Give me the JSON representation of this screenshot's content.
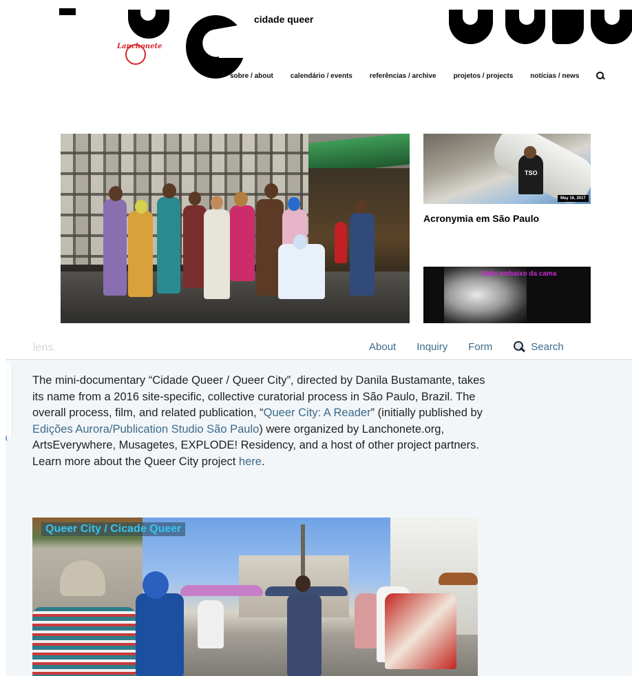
{
  "site": {
    "title": "cidade queer",
    "logo_text": "Lanchonete",
    "nav": [
      "sobre / about",
      "calendário / events",
      "referências / archive",
      "projetos / projects",
      "notícias / news"
    ]
  },
  "posts": [
    {
      "title": "Acronymia em São Paulo",
      "date": "May 16, 2017",
      "image_text": "TSO"
    },
    {
      "title": "Mala embaixo da cama"
    }
  ],
  "overlay": {
    "faded_text": "lens.",
    "nav": {
      "about": "About",
      "inquiry": "Inquiry",
      "form": "Form",
      "search": "Search"
    },
    "paragraph": {
      "t1": "The mini-documentary “Cidade Queer / Queer City”, directed by Danila Bustamante, takes its name from a 2016 site-specific, collective curatorial process in São Paulo, Brazil. The overall process, film, and related publication, “",
      "link1": "Queer City: A Reader",
      "t2": "” (initially published by ",
      "link2": "Edições Aurora/Publication Studio São Paulo",
      "t3": ") were organized by Lanchonete.org, ArtsEverywhere, Musagetes, EXPLODE! Residency, and a host of other project partners. Learn more about the Queer City project ",
      "link3": "here",
      "t4": "."
    },
    "photo_caption": "Queer City / Cicade Queer"
  },
  "colors": {
    "link": "#3d6a8a",
    "caption": "#35c4f1",
    "logo_red": "#d8232a",
    "post_title_magenta": "#c62bd0"
  }
}
